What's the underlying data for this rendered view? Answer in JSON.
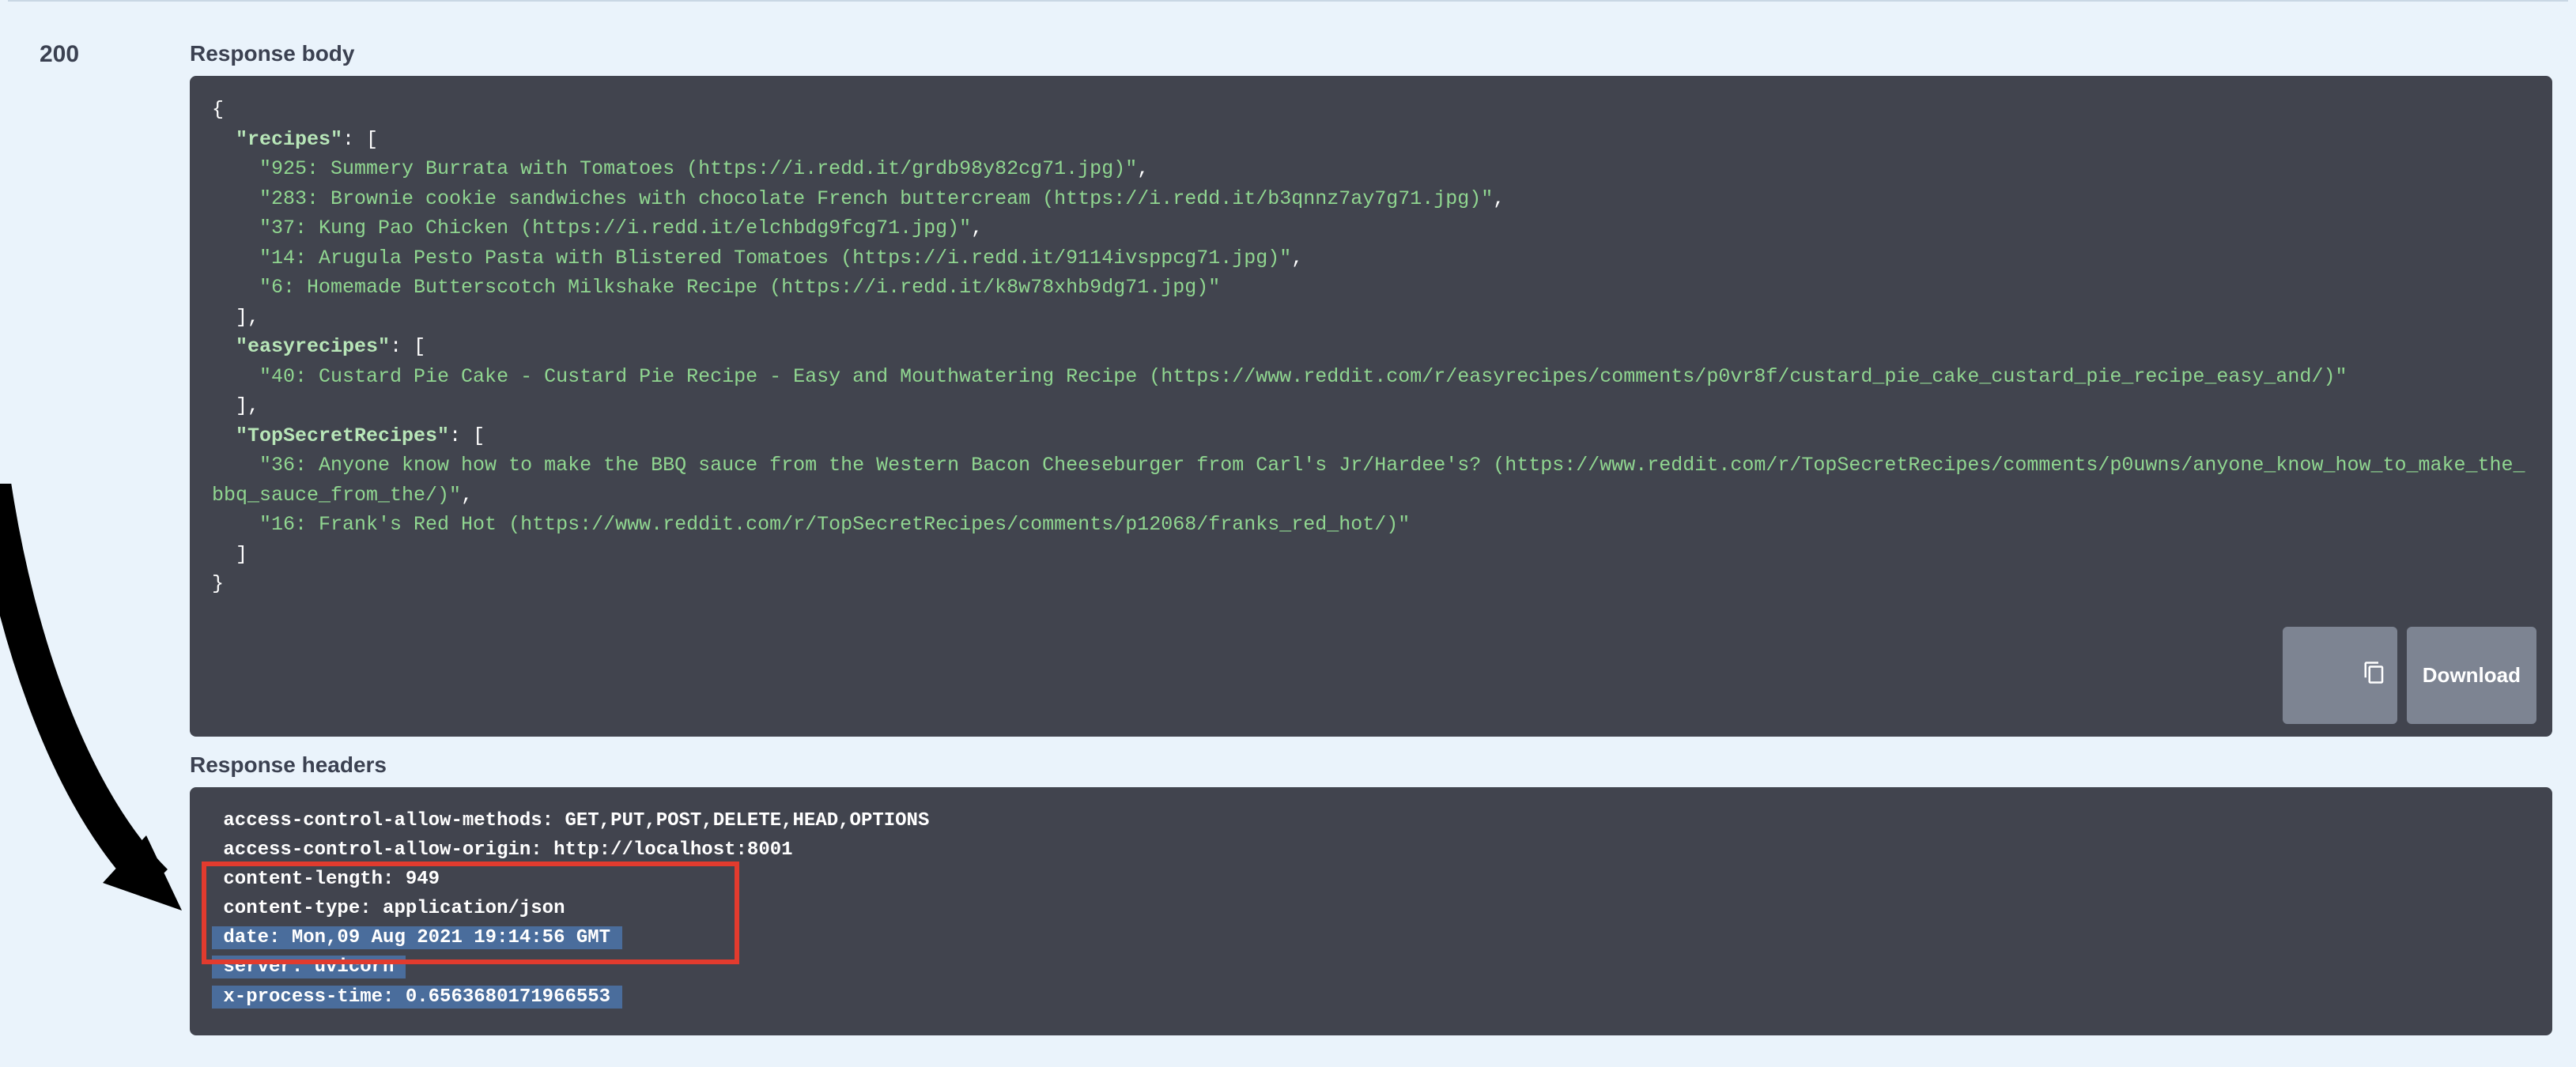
{
  "status_code": "200",
  "labels": {
    "response_body": "Response body",
    "response_headers": "Response headers",
    "download": "Download"
  },
  "response_body": {
    "recipes": [
      "925: Summery Burrata with Tomatoes (https://i.redd.it/grdb98y82cg71.jpg)",
      "283: Brownie cookie sandwiches with chocolate French buttercream (https://i.redd.it/b3qnnz7ay7g71.jpg)",
      "37: Kung Pao Chicken (https://i.redd.it/elchbdg9fcg71.jpg)",
      "14: Arugula Pesto Pasta with Blistered Tomatoes (https://i.redd.it/9114ivsppcg71.jpg)",
      "6: Homemade Butterscotch Milkshake Recipe (https://i.redd.it/k8w78xhb9dg71.jpg)"
    ],
    "easyrecipes": [
      "40: Custard Pie Cake - Custard Pie Recipe - Easy and Mouthwatering Recipe (https://www.reddit.com/r/easyrecipes/comments/p0vr8f/custard_pie_cake_custard_pie_recipe_easy_and/)"
    ],
    "TopSecretRecipes": [
      "36: Anyone know how to make the BBQ sauce from the Western Bacon Cheeseburger from Carl's Jr/Hardee's? (https://www.reddit.com/r/TopSecretRecipes/comments/p0uwns/anyone_know_how_to_make_the_bbq_sauce_from_the/)",
      "16: Frank's Red Hot (https://www.reddit.com/r/TopSecretRecipes/comments/p12068/franks_red_hot/)"
    ]
  },
  "response_headers": {
    "plain": [
      "access-control-allow-methods: GET,PUT,POST,DELETE,HEAD,OPTIONS",
      "access-control-allow-origin: http://localhost:8001",
      "content-length: 949",
      "content-type: application/json"
    ],
    "highlighted": [
      "date: Mon,09 Aug 2021 19:14:56 GMT",
      "server: uvicorn",
      "x-process-time: 0.6563680171966553"
    ]
  }
}
